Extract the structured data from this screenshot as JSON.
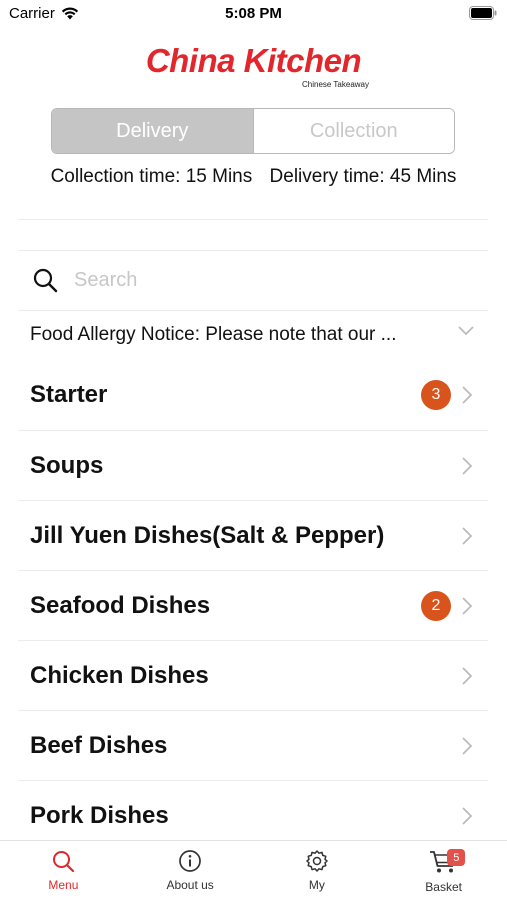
{
  "status_bar": {
    "carrier": "Carrier",
    "time": "5:08 PM"
  },
  "logo": {
    "title": "China Kitchen",
    "subtitle": "Chinese Takeaway",
    "color": "#e3262b"
  },
  "order_mode": {
    "options": [
      "Delivery",
      "Collection"
    ],
    "selected": "Delivery"
  },
  "times": {
    "collection": "Collection time: 15 Mins",
    "delivery": "Delivery time: 45 Mins"
  },
  "search": {
    "placeholder": "Search",
    "value": ""
  },
  "allergy_notice": {
    "text": "Food Allergy Notice: Please note that our ..."
  },
  "categories": [
    {
      "label": "Starter",
      "badge": "3"
    },
    {
      "label": "Soups",
      "badge": ""
    },
    {
      "label": "Jill Yuen Dishes(Salt & Pepper)",
      "badge": ""
    },
    {
      "label": "Seafood Dishes",
      "badge": "2"
    },
    {
      "label": "Chicken Dishes",
      "badge": ""
    },
    {
      "label": "Beef Dishes",
      "badge": ""
    },
    {
      "label": "Pork Dishes",
      "badge": ""
    }
  ],
  "tabbar": {
    "items": [
      {
        "label": "Menu",
        "icon": "search-icon",
        "active": true
      },
      {
        "label": "About us",
        "icon": "info-icon",
        "active": false
      },
      {
        "label": "My",
        "icon": "gear-icon",
        "active": false
      },
      {
        "label": "Basket",
        "icon": "cart-icon",
        "active": false,
        "badge": "5"
      }
    ]
  },
  "colors": {
    "accent": "#e3262b",
    "badge": "#d9541c",
    "segment_active": "#c5c5c5"
  }
}
